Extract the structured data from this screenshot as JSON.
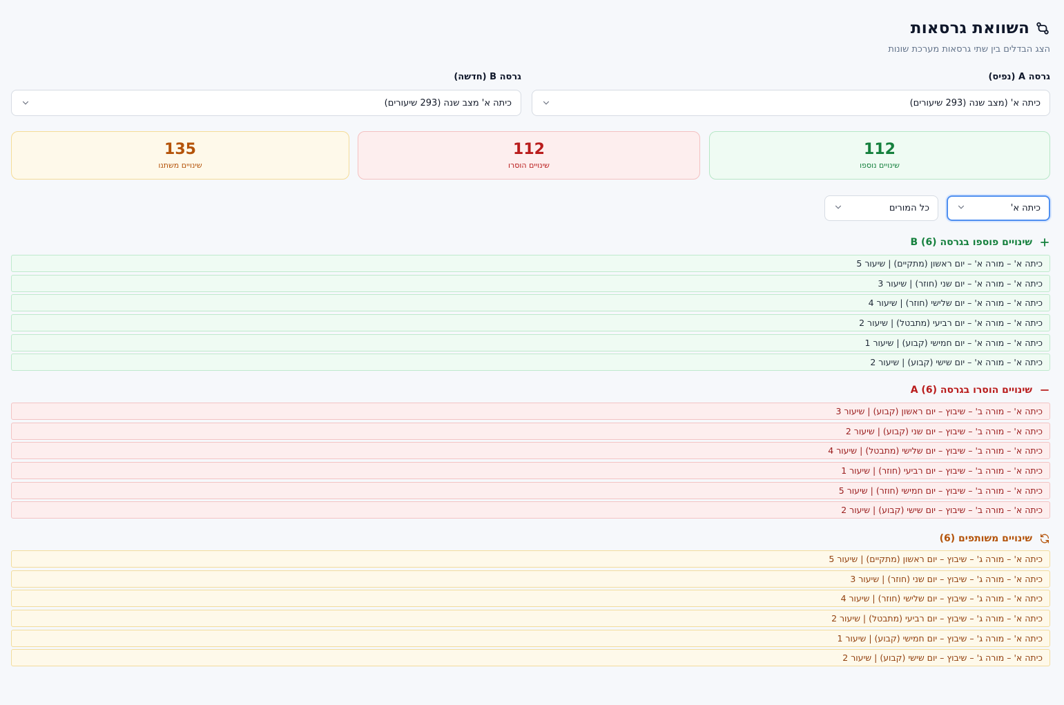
{
  "header": {
    "title": "השוואת גרסאות",
    "subtitle": "הצג הבדלים בין שתי גרסאות מערכת שונות",
    "icon": "git-compare-icon"
  },
  "versions": {
    "a": {
      "label": "גרסה A (נפיס)",
      "selected": "כיתה א' (מצב שנה (293 שיעורים)"
    },
    "b": {
      "label": "גרסה B (חדשה)",
      "selected": "כיתה א' מצב שנה (293 שיעורים)"
    }
  },
  "stats": {
    "added": {
      "value": "112",
      "label": "שינויים נוספו"
    },
    "removed": {
      "value": "112",
      "label": "שינויים הוסרו"
    },
    "changed": {
      "value": "135",
      "label": "שינויים משתנו"
    }
  },
  "filters": {
    "class": "כיתה א'",
    "teacher": "כל המורים"
  },
  "sections": {
    "added": {
      "title": "שינויים פוספו בגרסה B (6)",
      "rows": [
        "כיתה א' – מורה א' –  יום ראשון (מתקיים) | שיעור 5",
        "כיתה א' – מורה א' –  יום  שני (חוזר) | שיעור 3",
        "כיתה א' – מורה א' –  יום שלישי (חוזר) | שיעור 4",
        "כיתה א' – מורה א' –  יום רביעי (מתבטל) |  שיעור 2",
        "כיתה א' – מורה א' –  יום חמישי (קבוע) | שיעור 1",
        "כיתה א' – מורה א' –  יום  שישי (קבוע) | שיעור 2"
      ]
    },
    "removed": {
      "title": "שינויים הוסרו בגרסה A (6)",
      "rows": [
        "כיתה א' – מורה ב' – שיבוץ  – יום ראשון (קבוע) |  שיעור 3",
        "כיתה א' – מורה ב' – שיבוץ  – יום שני (קבוע) |  שיעור 2",
        "כיתה א' – מורה ב' – שיבוץ  – יום שלישי (מתבטל) |  שיעור 4",
        "כיתה א' – מורה ב' – שיבוץ  –  יום רביעי (חוזר) |  שיעור 1",
        "כיתה א' – מורה ב' – שיבוץ  –  יום חמישי (חוזר) |  שיעור 5",
        "כיתה א' – מורה ב' – שיבוץ  – יום שישי (קבוע) |  שיעור 2"
      ]
    },
    "changed": {
      "title": "שינויים משותפים (6)",
      "rows": [
        "כיתה א' – מורה ג' – שיבוץ  – יום ראשון (מתקיים) |  שיעור 5",
        "כיתה א' – מורה ג' – שיבוץ  – יום שני (חוזר) |  שיעור 3",
        "כיתה א' – מורה ג' – שיבוץ  – יום שלישי (חוזר) |  שיעור 4",
        "כיתה א' – מורה ג' – שיבוץ  – יום רביעי (מתבטל) | שיעור 2",
        "כיתה א' – מורה ג' – שיבוץ  – יום חמישי (קבוע) |  שיעור 1",
        "כיתה א' – מורה ג' – שיבוץ  – יום שישי (קבוע) |  שיעור 2"
      ]
    }
  },
  "colors": {
    "added": "#15803d",
    "removed": "#b91c1c",
    "changed": "#b45309",
    "focus": "#4f8ff0"
  }
}
